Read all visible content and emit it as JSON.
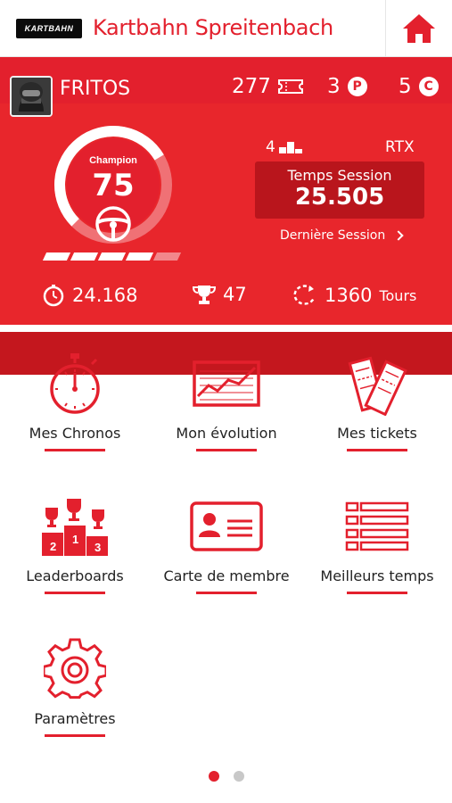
{
  "header": {
    "logo_text": "KARTBAHN",
    "title": "Kartbahn Spreitenbach",
    "home_icon": "home-icon"
  },
  "profile": {
    "username": "FRITOS",
    "tickets": "277",
    "points": "3",
    "credits": "5",
    "points_symbol": "P",
    "credits_symbol": "C",
    "level_label": "Champion",
    "level_value": "75",
    "level_progress": 0.72,
    "bars_filled": 4,
    "bars_total": 5,
    "position": "4",
    "kart": "RTX",
    "session_label": "Temps Session",
    "session_value": "25.505",
    "last_session": "Dernière Session"
  },
  "stats": {
    "best_time": "24.168",
    "trophies": "47",
    "laps": "1360",
    "laps_unit": "Tours"
  },
  "menu": [
    {
      "label": "Mes Chronos",
      "icon": "stopwatch-icon"
    },
    {
      "label": "Mon évolution",
      "icon": "chart-icon"
    },
    {
      "label": "Mes tickets",
      "icon": "tickets-icon"
    },
    {
      "label": "Leaderboards",
      "icon": "podium-icon"
    },
    {
      "label": "Carte de membre",
      "icon": "member-card-icon"
    },
    {
      "label": "Meilleurs temps",
      "icon": "list-icon"
    },
    {
      "label": "Paramètres",
      "icon": "gear-icon"
    }
  ],
  "pager": {
    "pages": 2,
    "active": 1
  },
  "colors": {
    "accent": "#e3202d",
    "panel": "#e8262c",
    "panel_dark": "#c4171e"
  }
}
